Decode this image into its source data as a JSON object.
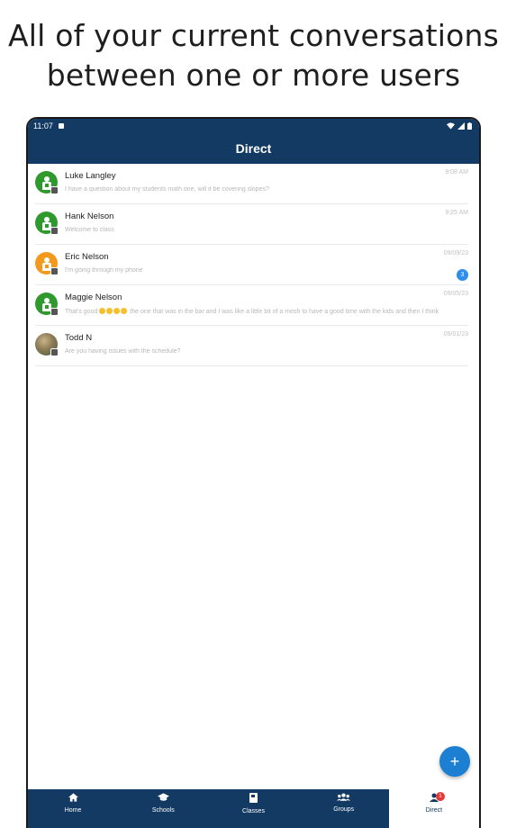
{
  "caption": {
    "line1": "All of your current conversations",
    "line2": "between one or more users"
  },
  "statusbar": {
    "time": "11:07"
  },
  "appbar": {
    "title": "Direct"
  },
  "conversations": [
    {
      "name": "Luke Langley",
      "preview": "I have a question about my students math one, will it be covering slopes?",
      "time": "9:08 AM",
      "avatar": "green",
      "avatar_icon": "user-icon"
    },
    {
      "name": "Hank Nelson",
      "preview": "Welcome to class",
      "time": "9:25 AM",
      "avatar": "green",
      "avatar_icon": "user-icon"
    },
    {
      "name": "Eric Nelson",
      "preview": "I'm going through my phone",
      "time": "09/09/23",
      "avatar": "orange",
      "avatar_icon": "user-icon",
      "badge": "3"
    },
    {
      "name": "Maggie Nelson",
      "preview_before": "That's good",
      "preview_after": "the one that was in the bar and I was like a little bit of a mesh to have a good time with the kids and then I think",
      "time": "09/05/23",
      "avatar": "green",
      "avatar_icon": "user-icon"
    },
    {
      "name": "Todd N",
      "preview": "Are you having issues with the schedule?",
      "time": "09/01/23",
      "avatar": "photo",
      "avatar_icon": "photo-avatar"
    }
  ],
  "fab": {
    "label": "+"
  },
  "bottomnav": [
    {
      "label": "Home",
      "icon": "home-icon"
    },
    {
      "label": "Schools",
      "icon": "graduation-cap-icon"
    },
    {
      "label": "Classes",
      "icon": "book-icon"
    },
    {
      "label": "Groups",
      "icon": "group-icon"
    },
    {
      "label": "Direct",
      "icon": "person-icon",
      "badge": "1",
      "active": true
    }
  ]
}
